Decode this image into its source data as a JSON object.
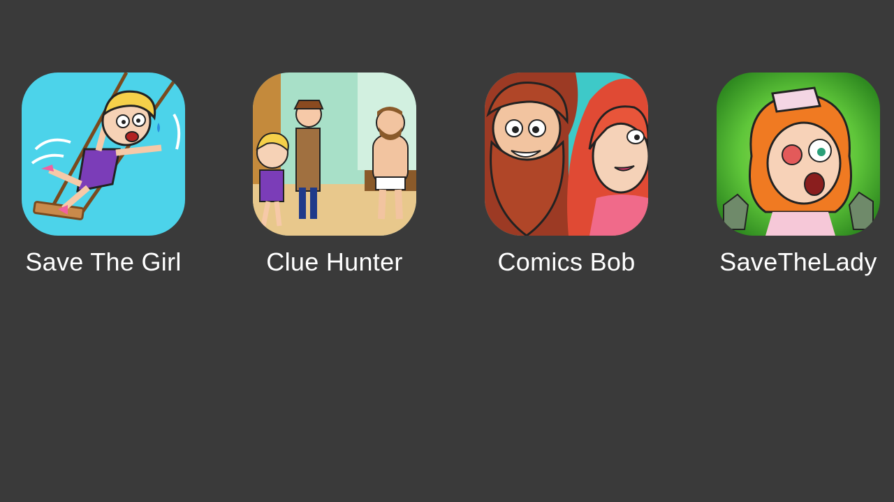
{
  "home_screen": {
    "apps": [
      {
        "label": "Save The Girl",
        "icon": "save-the-girl-app-icon"
      },
      {
        "label": "Clue Hunter",
        "icon": "clue-hunter-app-icon"
      },
      {
        "label": "Comics Bob",
        "icon": "comics-bob-app-icon"
      },
      {
        "label": "SaveTheLady",
        "icon": "save-the-lady-app-icon"
      }
    ]
  },
  "colors": {
    "background": "#3a3a3a",
    "label_text": "#ffffff",
    "save_the_girl_bg": "#4cd3ea",
    "clue_hunter_bg": "#a8e0c8",
    "comics_bob_bg": "#3ec9c8",
    "save_the_lady_bg": "#5fc63a"
  }
}
